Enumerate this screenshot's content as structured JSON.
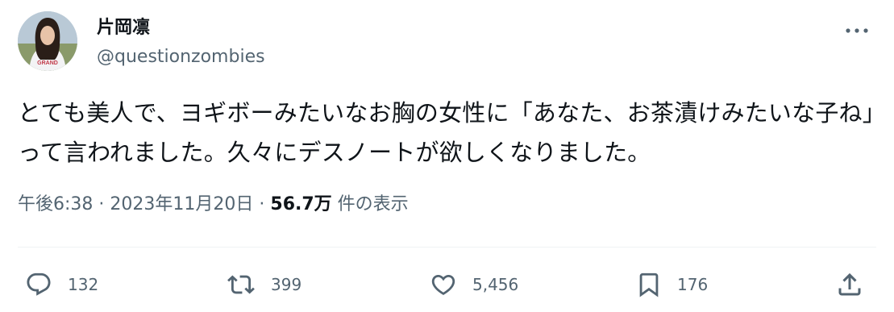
{
  "author": {
    "display_name": "片岡凛",
    "handle": "@questionzombies"
  },
  "tweet": {
    "text": "とても美人で、ヨギボーみたいなお胸の女性に「あなた、お茶漬けみたいな子ね」って言われました。久々にデスノートが欲しくなりました。"
  },
  "meta": {
    "time": "午後6:38",
    "separator": "·",
    "date": "2023年11月20日",
    "views_count": "56.7万",
    "views_label": "件の表示"
  },
  "actions": {
    "reply": {
      "icon": "reply-icon",
      "count": "132"
    },
    "retweet": {
      "icon": "retweet-icon",
      "count": "399"
    },
    "like": {
      "icon": "heart-icon",
      "count": "5,456"
    },
    "bookmark": {
      "icon": "bookmark-icon",
      "count": "176"
    },
    "share": {
      "icon": "share-icon"
    }
  },
  "colors": {
    "text": "#0f1419",
    "secondary": "#536471",
    "divider": "#eff3f4"
  }
}
